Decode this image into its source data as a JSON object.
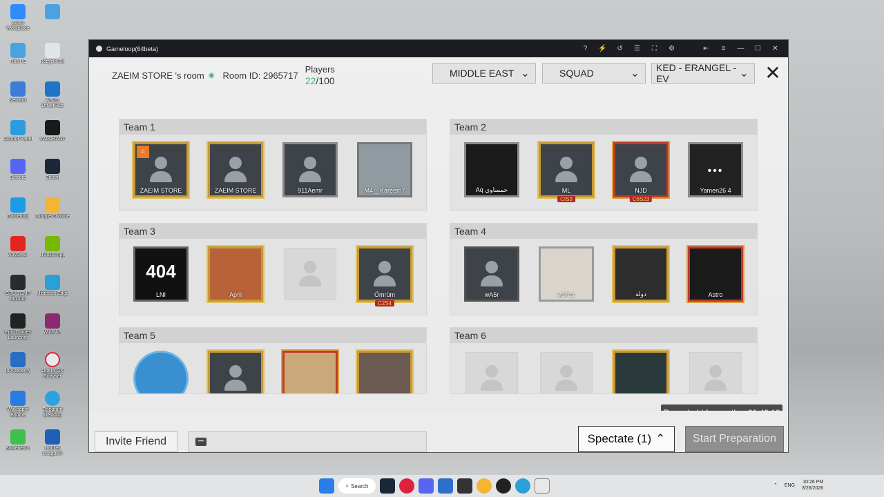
{
  "desktop": {
    "col1": [
      "Zoom Workplace",
      "This PC",
      "Network",
      "Control Panel",
      "Discord",
      "Gameloop",
      "AnyDesk",
      "GPU TEMP Monitor",
      "Epic Games Launcher",
      "Io Academy",
      "Wallpaper Engine",
      "Battlefield 6",
      "KICK - Live Streamin..."
    ],
    "col2": [
      "",
      "Recycle Bin",
      "ASUS DriverHub",
      "VALORANT",
      "Steam",
      "Google Chrome",
      "NVIDIA App",
      "Microsoft Edge",
      "WinRAR",
      "Opera GX Browser",
      "Telegram Desktop",
      "Rocket League®"
    ],
    "colors": [
      "#2d8cff",
      "#4aa3df",
      "#3b7dd8",
      "#2e9be0",
      "#5865f2",
      "#1c9be6",
      "#e2261d",
      "#2b2b2b",
      "#222222",
      "#2b6cc4",
      "#2a7be0",
      "#3fbf4f",
      "#1b6fd8"
    ]
  },
  "window": {
    "title": "Gameloop(64beta)",
    "controls": [
      "?",
      "⚡",
      "↺",
      "☰",
      "⛶",
      "⚙",
      "⇤",
      "≡",
      "—",
      "☐",
      "✕"
    ]
  },
  "room": {
    "owner": "ZAEIM STORE 's room",
    "room_id": "Room ID: 2965717",
    "players_label": "Players",
    "players_current": "22",
    "players_max": "/100"
  },
  "filters": {
    "region": "MIDDLE EAST",
    "mode": "SQUAD",
    "map": "KED - ERANGEL - EV"
  },
  "teams": [
    {
      "label": "Team 1",
      "players": [
        "ZAEIM STORE",
        "ZAEIM STORE",
        "911Aemr",
        "M4 _ Kareem7"
      ]
    },
    {
      "label": "Team 2",
      "players": [
        "Aq حمساوي",
        "ML",
        "NJD",
        "Yamen26 4"
      ]
    },
    {
      "label": "Team 3",
      "players": [
        "LNI",
        "April",
        "",
        "Ömrüm"
      ]
    },
    {
      "label": "Team 4",
      "players": [
        "wA5r",
        "ya7ea",
        "دولة",
        "Astro"
      ]
    },
    {
      "label": "Team 5",
      "players": [
        "",
        "",
        "",
        ""
      ]
    },
    {
      "label": "Team 6",
      "players": [
        "",
        "",
        "",
        ""
      ]
    }
  ],
  "badges": {
    "cis3": "CIS3",
    "c6s23": "C6S23",
    "c2s4": "C2S4",
    "error404": "404"
  },
  "bottom": {
    "invite_label": "Invite Friend",
    "spectate_label": "Spectate (1)",
    "start_label": "Start Preparation",
    "held_text": "Room held for another 01:49:18"
  },
  "taskbar": {
    "search_label": "Search",
    "lang": "ENG",
    "time": "10:26 PM",
    "date": "3/26/2026"
  }
}
